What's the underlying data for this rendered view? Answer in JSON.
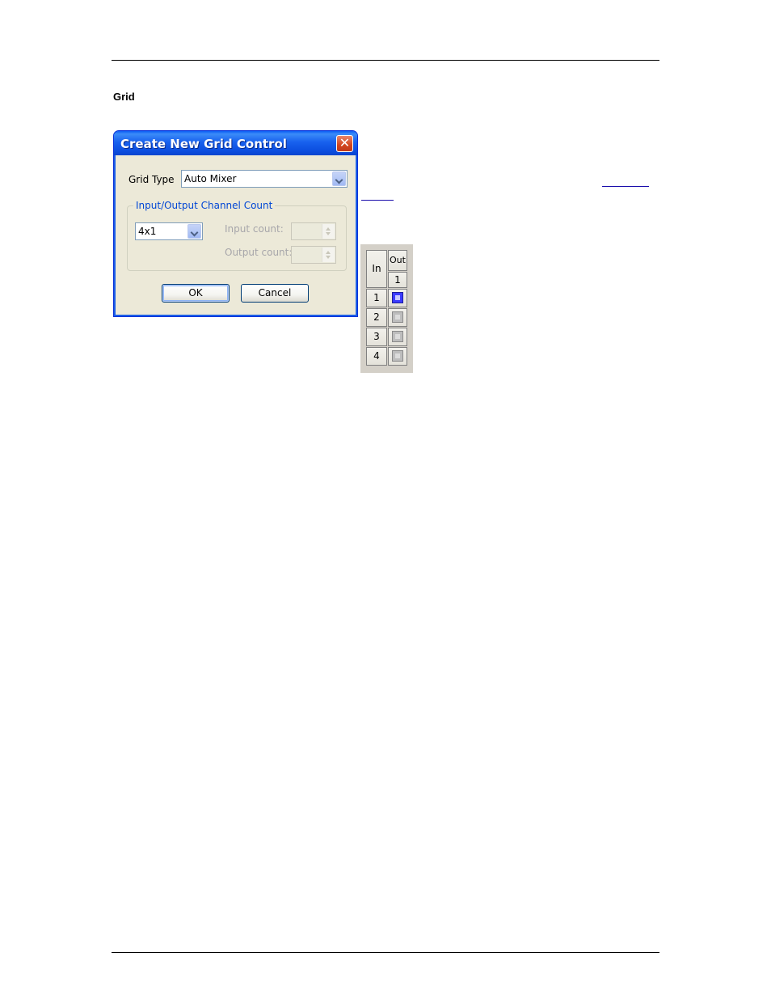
{
  "document": {
    "section_heading": "Grid"
  },
  "dialog": {
    "title": "Create New Grid Control",
    "close_glyph": "✕",
    "grid_type_label": "Grid Type",
    "grid_type_value": "Auto Mixer",
    "group_title": "Input/Output Channel Count",
    "channel_count_value": "4x1",
    "input_count_label": "Input count:",
    "output_count_label": "Output count:",
    "ok_label": "OK",
    "cancel_label": "Cancel"
  },
  "grid_preview": {
    "in_header": "In",
    "out_header": "Out",
    "output_columns": [
      "1"
    ],
    "rows": [
      {
        "label": "1",
        "active": true
      },
      {
        "label": "2",
        "active": false
      },
      {
        "label": "3",
        "active": false
      },
      {
        "label": "4",
        "active": false
      }
    ]
  },
  "colors": {
    "titlebar": "#0c4fe0",
    "dialog_bg": "#ece9d8",
    "group_title": "#0046d5",
    "active_cell": "#3b3bff",
    "inactive_cell": "#bdbdbd"
  }
}
